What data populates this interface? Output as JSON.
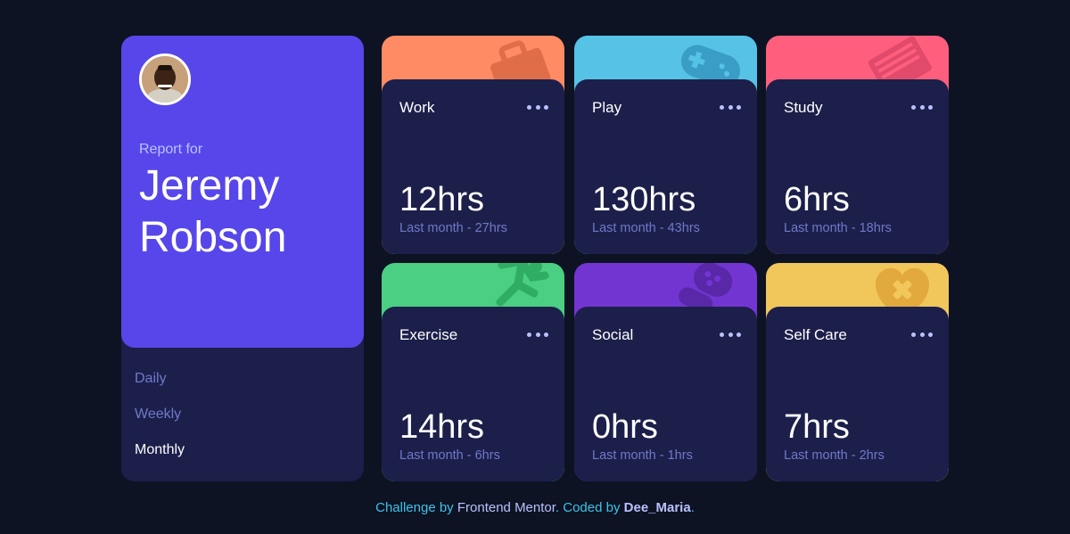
{
  "profile": {
    "report_label": "Report for",
    "name_first": "Jeremy",
    "name_last": "Robson"
  },
  "periods": [
    {
      "label": "Daily",
      "active": false
    },
    {
      "label": "Weekly",
      "active": false
    },
    {
      "label": "Monthly",
      "active": true
    }
  ],
  "cards": [
    {
      "title": "Work",
      "hours": "12hrs",
      "previous": "Last month - 27hrs",
      "color": "#ff8b64",
      "icon": "briefcase-icon"
    },
    {
      "title": "Play",
      "hours": "130hrs",
      "previous": "Last month - 43hrs",
      "color": "#55c2e6",
      "icon": "gamepad-icon"
    },
    {
      "title": "Study",
      "hours": "6hrs",
      "previous": "Last month - 18hrs",
      "color": "#ff5e7d",
      "icon": "book-icon"
    },
    {
      "title": "Exercise",
      "hours": "14hrs",
      "previous": "Last month - 6hrs",
      "color": "#4bcf82",
      "icon": "running-icon"
    },
    {
      "title": "Social",
      "hours": "0hrs",
      "previous": "Last month - 1hrs",
      "color": "#7335d2",
      "icon": "balloon-icon"
    },
    {
      "title": "Self Care",
      "hours": "7hrs",
      "previous": "Last month - 2hrs",
      "color": "#f1c75b",
      "icon": "heart-icon"
    }
  ],
  "footer": {
    "prefix": "Challenge by",
    "mentor": "Frontend Mentor",
    "middle": ". Coded by",
    "author": "Dee_Maria",
    "suffix": "."
  }
}
